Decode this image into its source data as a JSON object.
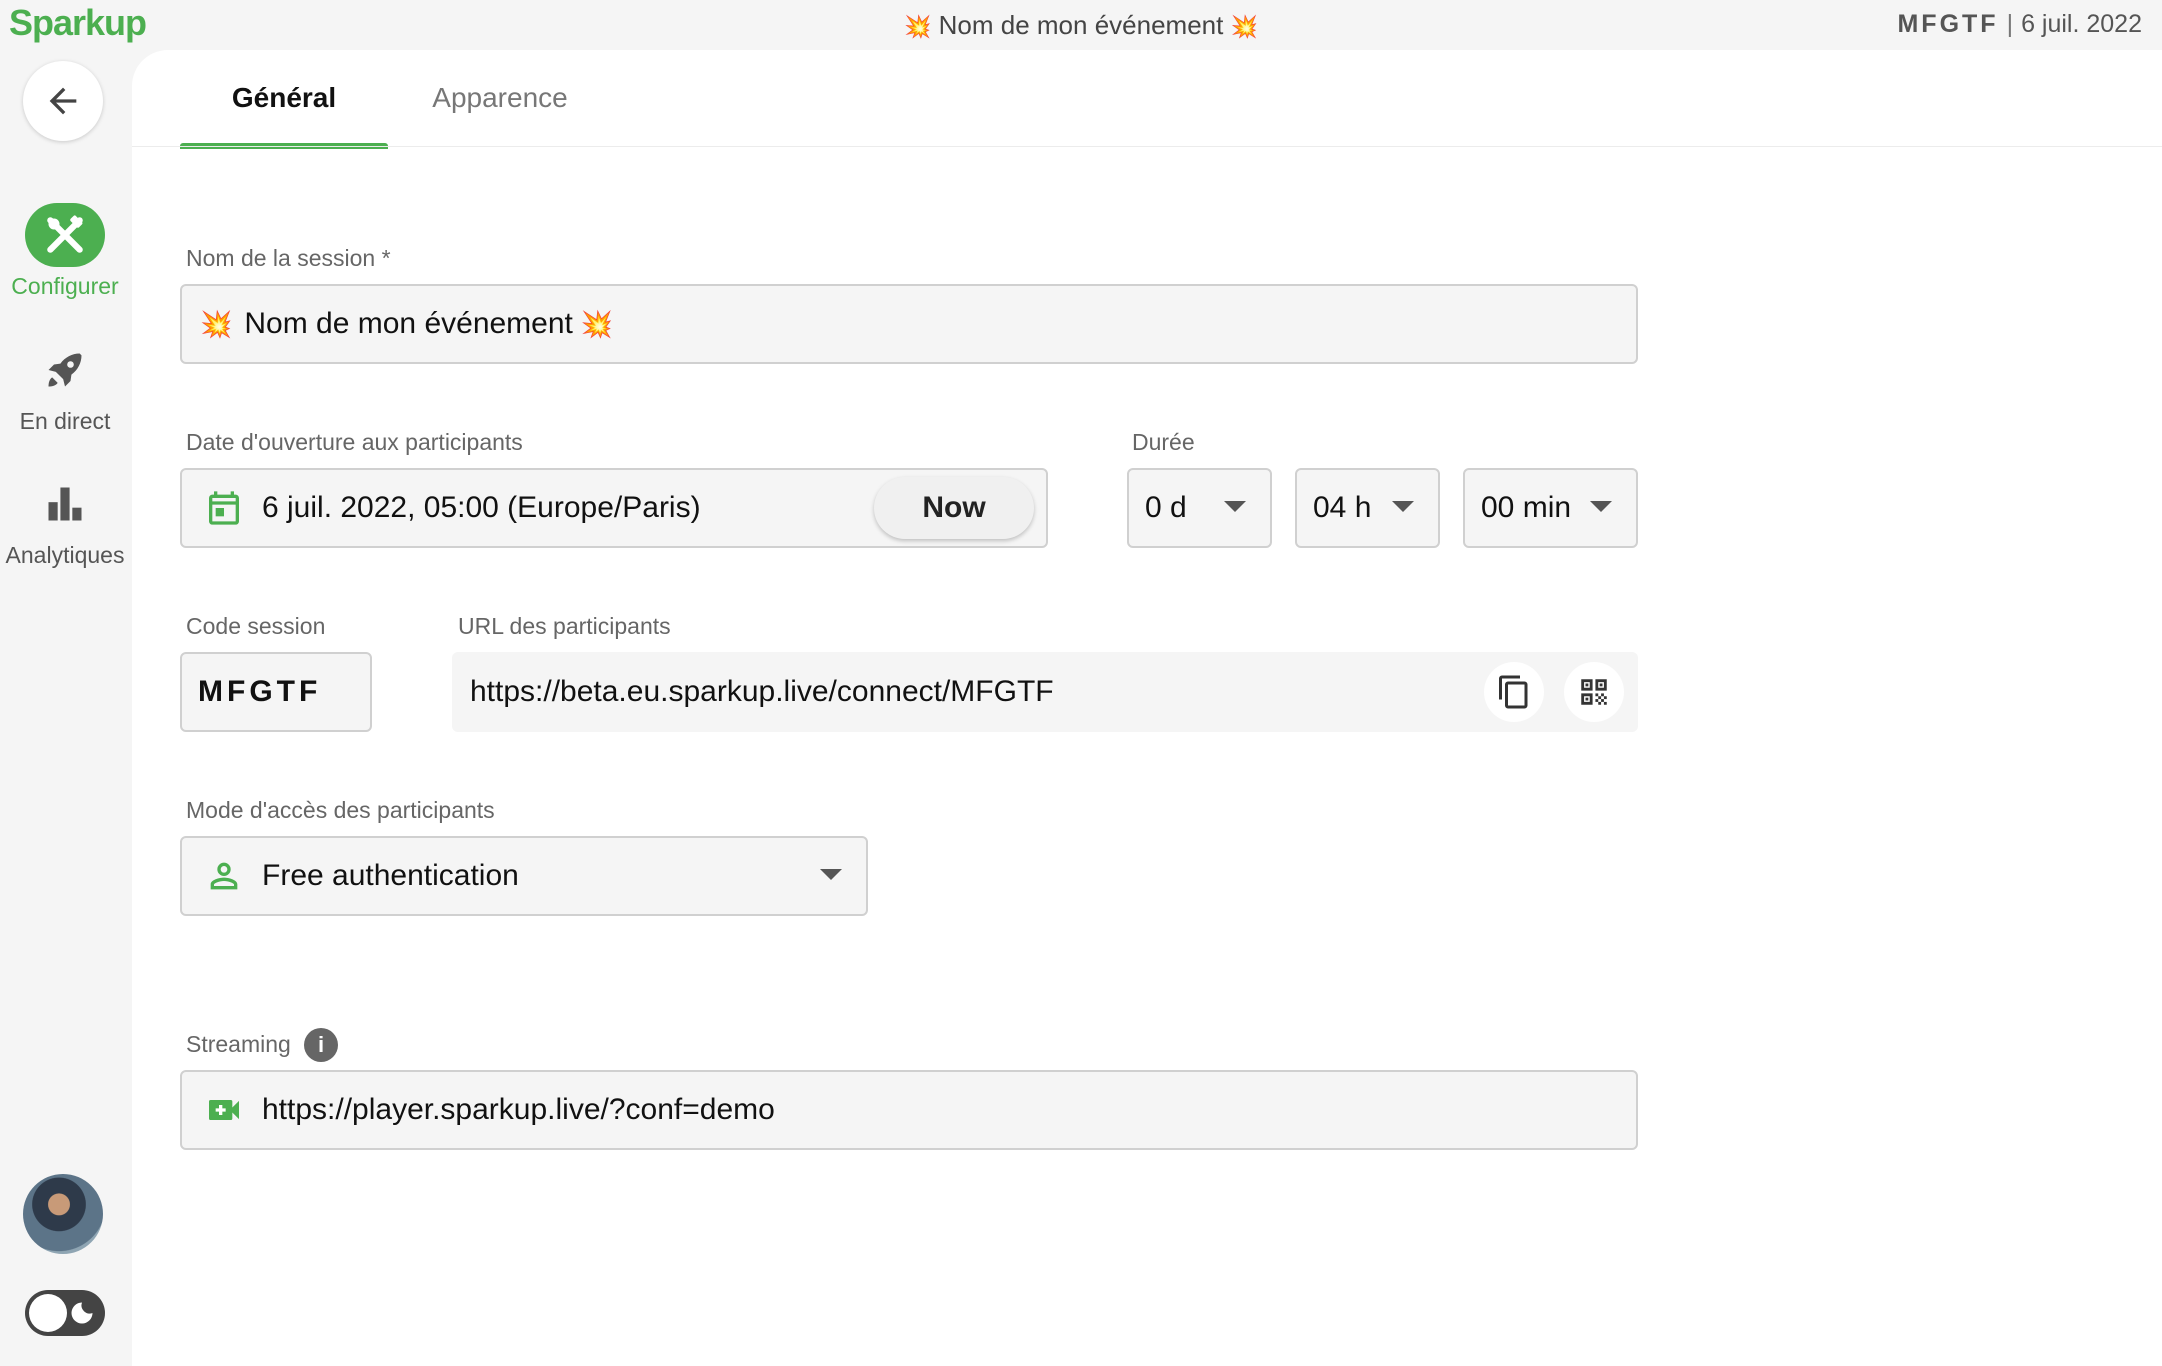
{
  "app": {
    "logo": "Sparkup",
    "title": "Nom de mon événement",
    "title_emoji": "💥",
    "session_code": "MFGTF",
    "date": "6 juil. 2022",
    "separator": "|"
  },
  "sidebar": {
    "items": [
      {
        "label": "Configurer",
        "icon": "tools-icon",
        "active": true
      },
      {
        "label": "En direct",
        "icon": "rocket-icon",
        "active": false
      },
      {
        "label": "Analytiques",
        "icon": "bar-chart-icon",
        "active": false
      }
    ]
  },
  "tabs": [
    {
      "label": "Général",
      "active": true
    },
    {
      "label": "Apparence",
      "active": false
    }
  ],
  "form": {
    "session_name": {
      "label": "Nom de la session *",
      "value": "Nom de mon événement",
      "emoji": "💥"
    },
    "opening_date": {
      "label": "Date d'ouverture aux participants",
      "value": "6 juil. 2022, 05:00 (Europe/Paris)",
      "now_label": "Now"
    },
    "duration": {
      "label": "Durée",
      "days": "0 d",
      "hours": "04 h",
      "minutes": "00 min"
    },
    "code": {
      "label": "Code session",
      "value": "MFGTF"
    },
    "url": {
      "label": "URL des participants",
      "value": "https://beta.eu.sparkup.live/connect/MFGTF"
    },
    "access_mode": {
      "label": "Mode d'accès des participants",
      "value": "Free authentication"
    },
    "streaming": {
      "label": "Streaming",
      "value": "https://player.sparkup.live/?conf=demo",
      "info": "i"
    }
  },
  "colors": {
    "accent": "#4caf50",
    "burst": "#e53935"
  }
}
